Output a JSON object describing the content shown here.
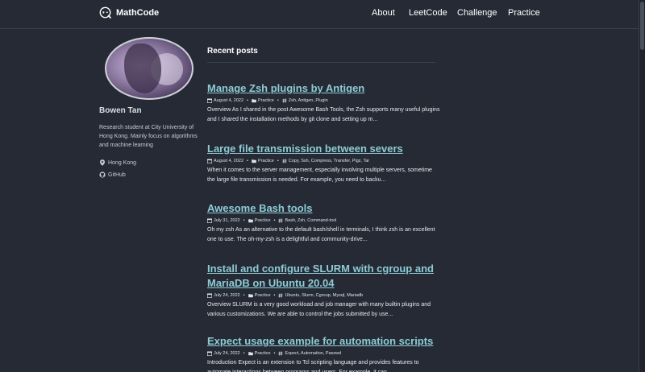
{
  "brand": {
    "name": "MathCode"
  },
  "nav": {
    "items": [
      "About",
      "LeetCode",
      "Challenge",
      "Practice"
    ]
  },
  "author": {
    "name": "Bowen Tan",
    "bio": "Research student at City University of Hong Kong. Mainly focus on algorithms and machine learning",
    "location": "Hong Kong",
    "github": "GitHub"
  },
  "main": {
    "section_title": "Recent posts"
  },
  "posts": [
    {
      "title": "Manage Zsh plugins by Antigen",
      "date": "August 4, 2022",
      "category": "Practice",
      "tags": "Zsh, Antigen, Plugin",
      "excerpt": "Overview As I shared in the post Awesome Bash Tools, the Zsh supports many useful plugins and I shared the installation methods by git clone and setting up m..."
    },
    {
      "title": "Large file transmission between severs",
      "date": "August 4, 2022",
      "category": "Practice",
      "tags": "Copy, Ssh, Compress, Transfer, Pigz, Tar",
      "excerpt": "When it comes to the server management, especially involving multiple servers, sometime the large file transmission is needed. For example, you need to backu..."
    },
    {
      "title": "Awesome Bash tools",
      "date": "July 31, 2022",
      "category": "Practice",
      "tags": "Bash, Zsh, Command-tool",
      "excerpt": "Oh my zsh As an alternative to the default bash/shell in terminals, I think zsh is an excellent one to use. The oh-my-zsh is a delightful and community-drive..."
    },
    {
      "title": "Install and configure SLURM with cgroup and MariaDB on Ubuntu 20.04",
      "date": "July 24, 2022",
      "category": "Practice",
      "tags": "Ubuntu, Slurm, Cgroup, Mysql, Mariadb",
      "excerpt": "Overview SLURM is a very good workload and job manager with many builtin plugins and various customizations. We are able to control the jobs submitted by use..."
    },
    {
      "title": "Expect usage example for automation scripts",
      "date": "July 24, 2022",
      "category": "Practice",
      "tags": "Expect, Automation, Passwd",
      "excerpt": "Introduction Expect is an extension to Tcl scripting language and provides features to automate interactions between programs and users. For example, it can..."
    }
  ]
}
